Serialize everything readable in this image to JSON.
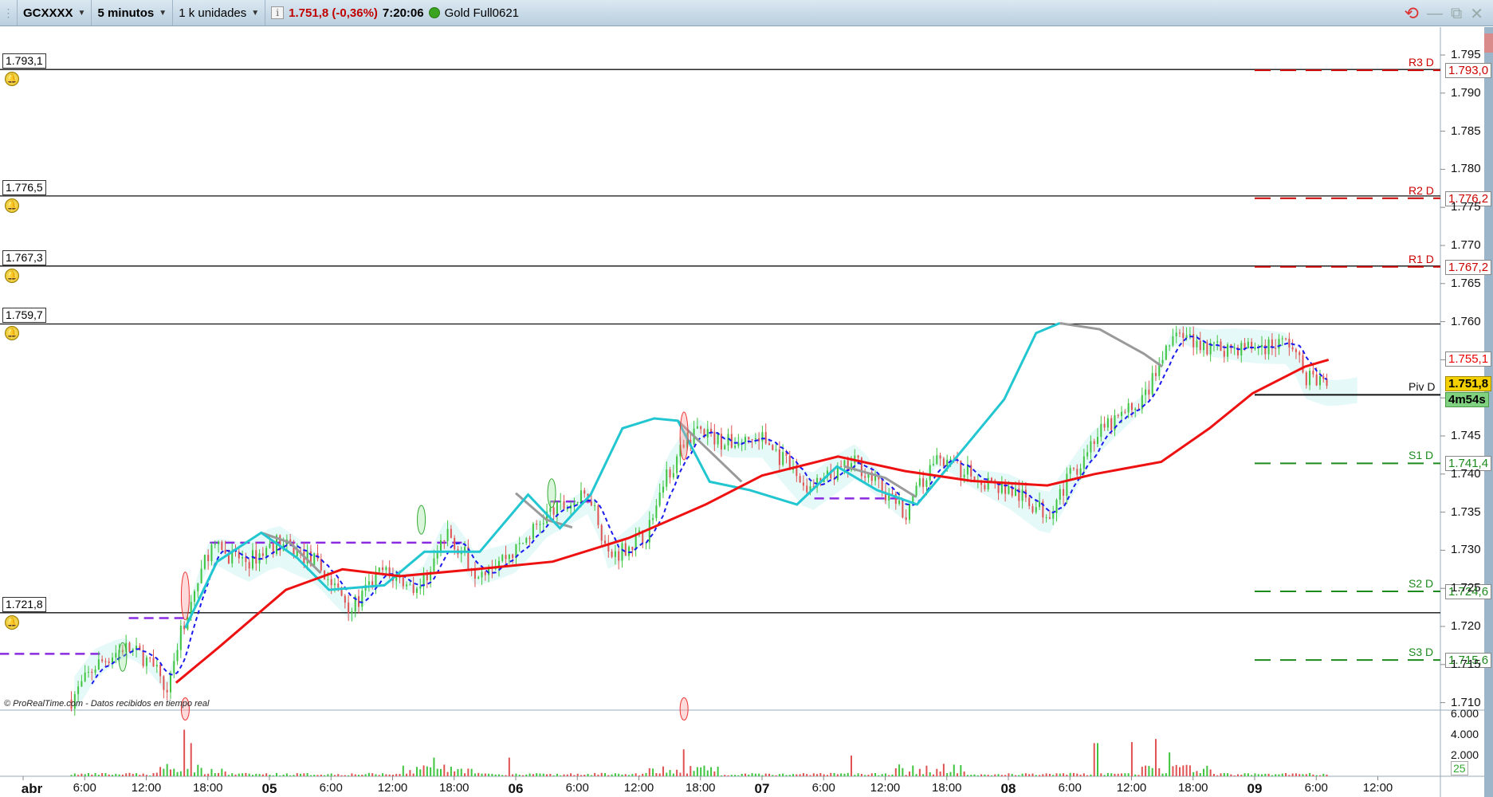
{
  "toolbar": {
    "symbol": "GCXXXX",
    "timeframe": "5 minutos",
    "units": "1 k unidades",
    "last_price": "1.751,8 (-0,36%)",
    "time": "7:20:06",
    "feed": "Gold Full0621"
  },
  "colors": {
    "up": "#3fc43f",
    "down": "#e05252",
    "ma_long": "#ee1111",
    "ma_fast": "#22c6d0",
    "ma_gray": "#9a9a9a",
    "signal": "#1a1aee",
    "range": "#8a2be2",
    "pivot_r": "#cc0000",
    "pivot_s": "#1d8a1d"
  },
  "alerts": [
    {
      "label": "1.793,1",
      "price": 1793.1
    },
    {
      "label": "1.776,5",
      "price": 1776.5
    },
    {
      "label": "1.767,3",
      "price": 1767.3
    },
    {
      "label": "1.759,7",
      "price": 1759.7
    },
    {
      "label": "1.721,8",
      "price": 1721.8
    }
  ],
  "pivots": [
    {
      "name": "R3 D",
      "value": "1.793,0",
      "price": 1793.0,
      "kind": "r"
    },
    {
      "name": "R2 D",
      "value": "1.776,2",
      "price": 1776.2,
      "kind": "r"
    },
    {
      "name": "R1 D",
      "value": "1.767,2",
      "price": 1767.2,
      "kind": "r"
    },
    {
      "name": "Piv D",
      "value": "",
      "price": 1750.4,
      "kind": "p"
    },
    {
      "name": "S1 D",
      "value": "1.741,4",
      "price": 1741.4,
      "kind": "s"
    },
    {
      "name": "S2 D",
      "value": "1.724,6",
      "price": 1724.6,
      "kind": "s"
    },
    {
      "name": "S3 D",
      "value": "1.715,6",
      "price": 1715.6,
      "kind": "s"
    }
  ],
  "price_axis": {
    "ticks": [
      "1.795",
      "1.790",
      "1.785",
      "1.780",
      "1.775",
      "1.770",
      "1.765",
      "1.760",
      "1.755",
      "1.750",
      "1.745",
      "1.740",
      "1.735",
      "1.730",
      "1.725",
      "1.720",
      "1.715",
      "1.710"
    ],
    "current": "1.751,8",
    "countdown": "4m54s",
    "marker_hi": "1.755,1"
  },
  "volume_axis": {
    "ticks": [
      "6.000",
      "4.000",
      "2.000"
    ],
    "current": "25"
  },
  "time_axis": [
    {
      "h": 0,
      "label": "abr",
      "day": true
    },
    {
      "h": 6,
      "label": "6:00"
    },
    {
      "h": 12,
      "label": "12:00"
    },
    {
      "h": 18,
      "label": "18:00"
    },
    {
      "h": 24,
      "label": "05",
      "day": true
    },
    {
      "h": 30,
      "label": "6:00"
    },
    {
      "h": 36,
      "label": "12:00"
    },
    {
      "h": 42,
      "label": "18:00"
    },
    {
      "h": 48,
      "label": "06",
      "day": true
    },
    {
      "h": 54,
      "label": "6:00"
    },
    {
      "h": 60,
      "label": "12:00"
    },
    {
      "h": 66,
      "label": "18:00"
    },
    {
      "h": 72,
      "label": "07",
      "day": true
    },
    {
      "h": 78,
      "label": "6:00"
    },
    {
      "h": 84,
      "label": "12:00"
    },
    {
      "h": 90,
      "label": "18:00"
    },
    {
      "h": 96,
      "label": "08",
      "day": true
    },
    {
      "h": 102,
      "label": "6:00"
    },
    {
      "h": 108,
      "label": "12:00"
    },
    {
      "h": 114,
      "label": "18:00"
    },
    {
      "h": 120,
      "label": "09",
      "day": true
    },
    {
      "h": 126,
      "label": "6:00"
    },
    {
      "h": 132,
      "label": "12:00"
    }
  ],
  "credit": "© ProRealTime.com - Datos recibidos en tiempo real",
  "chart_data": {
    "type": "candlestick",
    "x_unit": "hours since 04 abr 00:00",
    "price_path": [
      [
        4.7,
        1710.4
      ],
      [
        7.0,
        1714.8
      ],
      [
        9.8,
        1717.3
      ],
      [
        11.7,
        1716
      ],
      [
        14.0,
        1712.3
      ],
      [
        15.8,
        1721
      ],
      [
        18.2,
        1730.4
      ],
      [
        21.9,
        1728.5
      ],
      [
        24.7,
        1731
      ],
      [
        28.4,
        1728.5
      ],
      [
        30.2,
        1725.4
      ],
      [
        32.1,
        1722.3
      ],
      [
        34.9,
        1727.3
      ],
      [
        38.6,
        1725
      ],
      [
        41.4,
        1732.3
      ],
      [
        44.1,
        1727.3
      ],
      [
        47.9,
        1729.8
      ],
      [
        51.1,
        1734.8
      ],
      [
        55.3,
        1737.3
      ],
      [
        57.1,
        1729
      ],
      [
        60.8,
        1732.3
      ],
      [
        62.7,
        1739.8
      ],
      [
        65.5,
        1746
      ],
      [
        68.3,
        1744
      ],
      [
        72.0,
        1744.8
      ],
      [
        76.6,
        1737.9
      ],
      [
        81.2,
        1741.6
      ],
      [
        85.9,
        1734.8
      ],
      [
        89.1,
        1742.3
      ],
      [
        92.4,
        1739.8
      ],
      [
        96.1,
        1737.9
      ],
      [
        99.8,
        1734.8
      ],
      [
        104.4,
        1744.8
      ],
      [
        109.1,
        1749.8
      ],
      [
        112.3,
        1758.5
      ],
      [
        115.6,
        1756.6
      ],
      [
        119.3,
        1756.6
      ],
      [
        123.5,
        1757.3
      ],
      [
        124.9,
        1752.9
      ],
      [
        127.2,
        1751.8
      ]
    ],
    "ma_long": [
      [
        14.9,
        1712.6
      ],
      [
        19.1,
        1717.3
      ],
      [
        25.6,
        1724.8
      ],
      [
        31.1,
        1727.5
      ],
      [
        36.7,
        1726.6
      ],
      [
        44.1,
        1727.5
      ],
      [
        51.6,
        1728.5
      ],
      [
        59.0,
        1731.6
      ],
      [
        66.5,
        1736
      ],
      [
        72.0,
        1739.8
      ],
      [
        79.4,
        1742.3
      ],
      [
        85.9,
        1740.4
      ],
      [
        92.4,
        1739.1
      ],
      [
        99.8,
        1738.5
      ],
      [
        104.4,
        1740
      ],
      [
        110.9,
        1741.6
      ],
      [
        115.6,
        1746
      ],
      [
        119.8,
        1750.6
      ],
      [
        124.9,
        1754.1
      ],
      [
        127.2,
        1755
      ]
    ],
    "ma_fast": [
      [
        15.8,
        1719.8
      ],
      [
        18.9,
        1728.5
      ],
      [
        23.2,
        1732.3
      ],
      [
        26.7,
        1729
      ],
      [
        29.8,
        1724.8
      ],
      [
        35.2,
        1725.4
      ],
      [
        39.1,
        1729.8
      ],
      [
        44.5,
        1729.8
      ],
      [
        49.2,
        1737.3
      ],
      [
        52.3,
        1732.9
      ],
      [
        55.3,
        1737.3
      ],
      [
        58.4,
        1746
      ],
      [
        61.5,
        1747.3
      ],
      [
        63.8,
        1747
      ],
      [
        66.9,
        1739
      ],
      [
        70.8,
        1737.9
      ],
      [
        75.4,
        1736
      ],
      [
        79.3,
        1741
      ],
      [
        83.2,
        1737.9
      ],
      [
        87.1,
        1736
      ],
      [
        91.0,
        1742.3
      ],
      [
        95.6,
        1749.8
      ],
      [
        98.7,
        1758.5
      ],
      [
        101.0,
        1759.8
      ]
    ],
    "ma_gray": [
      [
        [
          23.2,
          1732.3
        ],
        [
          26.0,
          1731
        ],
        [
          29.0,
          1727
        ]
      ],
      [
        [
          48.0,
          1737.5
        ],
        [
          51.0,
          1734
        ],
        [
          53.5,
          1733
        ]
      ],
      [
        [
          63.8,
          1747
        ],
        [
          66.9,
          1743
        ],
        [
          70.0,
          1739
        ]
      ],
      [
        [
          101.0,
          1759.8
        ],
        [
          104.9,
          1759
        ],
        [
          109.2,
          1755.8
        ],
        [
          111.0,
          1754.1
        ]
      ],
      [
        [
          80.0,
          1741
        ],
        [
          84.0,
          1739.5
        ],
        [
          87.0,
          1737
        ]
      ]
    ],
    "range_levels": [
      [
        -2.3,
        7.9,
        1716.4
      ],
      [
        10.3,
        15.8,
        1721.1
      ],
      [
        18.2,
        43.2,
        1731
      ],
      [
        51.4,
        55.3,
        1736.4
      ],
      [
        77.1,
        85.9,
        1736.8
      ]
    ],
    "pivot_start_hour": 120,
    "volume_ylim": [
      0,
      7000
    ],
    "volume_spikes": [
      [
        15.8,
        4500
      ],
      [
        16.5,
        3200
      ],
      [
        40.0,
        1800
      ],
      [
        47.5,
        1800
      ],
      [
        64.4,
        2600
      ],
      [
        80.6,
        2000
      ],
      [
        104.5,
        3200
      ],
      [
        108.1,
        3300
      ],
      [
        110.3,
        3600
      ],
      [
        111.6,
        2300
      ]
    ]
  }
}
